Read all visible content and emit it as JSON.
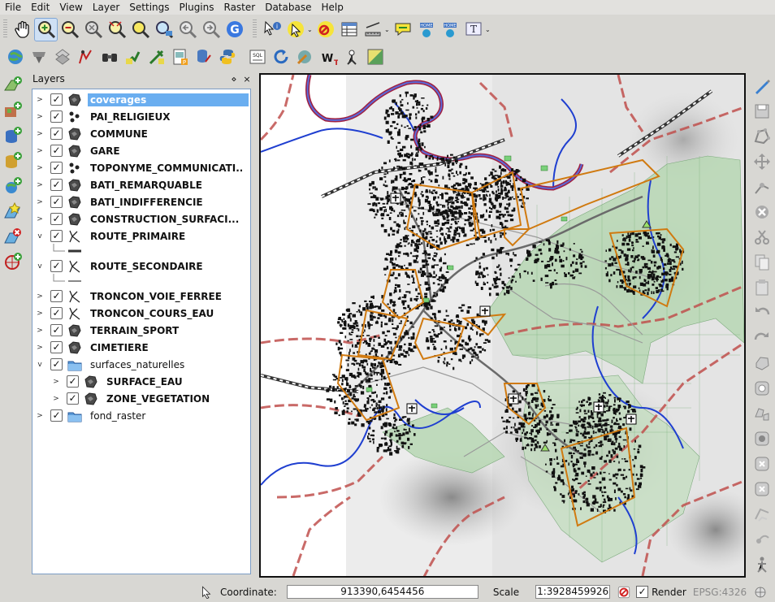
{
  "menu": [
    "File",
    "Edit",
    "View",
    "Layer",
    "Settings",
    "Plugins",
    "Raster",
    "Database",
    "Help"
  ],
  "toolbar1": [
    "pan-icon",
    "zoom-in-icon",
    "zoom-out-icon",
    "zoom-full-icon",
    "zoom-selection-icon",
    "zoom-layer-icon",
    "zoom-native-icon",
    "zoom-last-icon",
    "zoom-next-icon",
    "refresh-icon",
    "identify-icon",
    "select-icon",
    "deselect-icon",
    "attribute-table-icon",
    "measure-icon",
    "map-tips-icon",
    "new-bookmark-icon",
    "show-bookmarks-icon",
    "text-annotation-icon"
  ],
  "toolbar2": [
    "georeferencer-icon",
    "grass-icon",
    "spatial-query-icon",
    "road-graph-icon",
    "gps-icon",
    "plugin-a-icon",
    "plugin-b-icon",
    "print-composer-icon",
    "db-manager-icon",
    "python-console-icon",
    "sql-icon",
    "reload-icon",
    "plugin-manager-icon",
    "wkt-icon",
    "coordinate-capture-icon",
    "heatmap-icon"
  ],
  "lefttools": [
    "add-vector-layer-icon",
    "add-raster-layer-icon",
    "add-postgis-layer-icon",
    "add-spatialite-layer-icon",
    "add-wms-layer-icon",
    "new-layer-icon",
    "remove-layer-icon",
    "add-wfs-layer-icon"
  ],
  "righttools": [
    "toggle-editing-icon",
    "save-edits-icon",
    "add-feature-icon",
    "move-feature-icon",
    "node-tool-icon",
    "delete-selected-icon",
    "cut-features-icon",
    "copy-features-icon",
    "paste-features-icon",
    "undo-icon",
    "redo-icon",
    "simplify-icon",
    "add-ring-icon",
    "add-part-icon",
    "fill-ring-icon",
    "delete-ring-icon",
    "delete-part-icon",
    "reshape-icon",
    "offset-curve-icon",
    "split-icon"
  ],
  "layers_panel": {
    "title": "Layers",
    "float_btn": "⋄",
    "close_btn": "×"
  },
  "layers": [
    {
      "name": "coverages",
      "type": "polygon",
      "checked": "✓",
      "expander": ">"
    },
    {
      "name": "PAI_RELIGIEUX",
      "type": "point",
      "checked": "✓",
      "expander": ">"
    },
    {
      "name": "COMMUNE",
      "type": "polygon",
      "checked": "✓",
      "expander": ">"
    },
    {
      "name": "GARE",
      "type": "polygon",
      "checked": "✓",
      "expander": ">"
    },
    {
      "name": "TOPONYME_COMMUNICATI...",
      "type": "point",
      "checked": "✓",
      "expander": ">"
    },
    {
      "name": "BATI_REMARQUABLE",
      "type": "polygon",
      "checked": "✓",
      "expander": ">"
    },
    {
      "name": "BATI_INDIFFERENCIE",
      "type": "polygon",
      "checked": "✓",
      "expander": ">"
    },
    {
      "name": "CONSTRUCTION_SURFACI...",
      "type": "polygon",
      "checked": "✓",
      "expander": ">"
    },
    {
      "name": "ROUTE_PRIMAIRE",
      "type": "line",
      "checked": "✓",
      "expander": "v"
    },
    {
      "name": "ROUTE_SECONDAIRE",
      "type": "line",
      "checked": "✓",
      "expander": "v"
    },
    {
      "name": "TRONCON_VOIE_FERREE",
      "type": "line",
      "checked": "✓",
      "expander": ">"
    },
    {
      "name": "TRONCON_COURS_EAU",
      "type": "line",
      "checked": "✓",
      "expander": ">"
    },
    {
      "name": "TERRAIN_SPORT",
      "type": "polygon",
      "checked": "✓",
      "expander": ">"
    },
    {
      "name": "CIMETIERE",
      "type": "polygon",
      "checked": "✓",
      "expander": ">"
    },
    {
      "name": "surfaces_naturelles",
      "type": "group",
      "checked": "✓",
      "expander": "v"
    },
    {
      "name": "SURFACE_EAU",
      "type": "polygon",
      "checked": "✓",
      "expander": ">"
    },
    {
      "name": "ZONE_VEGETATION",
      "type": "polygon",
      "checked": "✓",
      "expander": ">"
    },
    {
      "name": "fond_raster",
      "type": "group",
      "checked": "✓",
      "expander": ">"
    }
  ],
  "status": {
    "coordinate_label": "Coordinate:",
    "coordinate": "913390,6454456",
    "scale_label": "Scale",
    "scale": "1:3928459926",
    "render_label": "Render",
    "render_checked": "✓",
    "crs": "EPSG:4326"
  },
  "colors": {
    "selection": "#6aaef0",
    "commune_border": "#c0504d",
    "coverage": "#d07a10",
    "water": "#1f3fd0",
    "vegetation": "#b8d8b4",
    "road": "#808080"
  }
}
